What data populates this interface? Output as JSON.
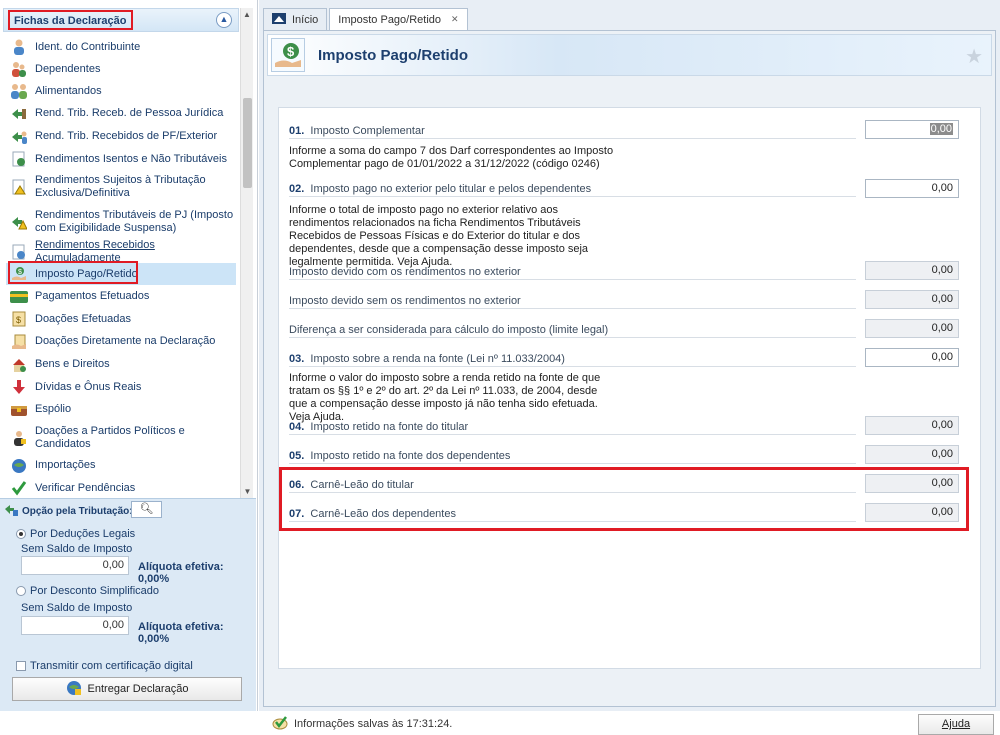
{
  "sidebar": {
    "title": "Fichas da Declaração",
    "items": [
      {
        "label": "Ident. do Contribuinte",
        "icon": "person-icon"
      },
      {
        "label": "Dependentes",
        "icon": "dependents-icon"
      },
      {
        "label": "Alimentandos",
        "icon": "alimentandos-icon"
      },
      {
        "label": "Rend. Trib. Receb. de Pessoa Jurídica",
        "icon": "income-pj-icon"
      },
      {
        "label": "Rend. Trib. Recebidos de PF/Exterior",
        "icon": "income-pf-icon"
      },
      {
        "label": "Rendimentos Isentos e Não Tributáveis",
        "icon": "exempt-income-icon"
      },
      {
        "label": "Rendimentos Sujeitos à Tributação Exclusiva/Definitiva",
        "icon": "exclusive-tax-icon"
      },
      {
        "label": "Rendimentos Tributáveis de PJ (Imposto com Exigibilidade Suspensa)",
        "icon": "suspended-tax-icon"
      },
      {
        "label": "Rendimentos Recebidos Acumuladamente",
        "icon": "accumulated-income-icon"
      },
      {
        "label": "Imposto Pago/Retido",
        "icon": "tax-paid-icon"
      },
      {
        "label": "Pagamentos Efetuados",
        "icon": "payments-icon"
      },
      {
        "label": "Doações Efetuadas",
        "icon": "donations-icon"
      },
      {
        "label": "Doações Diretamente na Declaração",
        "icon": "direct-donations-icon"
      },
      {
        "label": "Bens e Direitos",
        "icon": "assets-icon"
      },
      {
        "label": "Dívidas e Ônus Reais",
        "icon": "debts-icon"
      },
      {
        "label": "Espólio",
        "icon": "estate-icon"
      },
      {
        "label": "Doações a Partidos Políticos e Candidatos",
        "icon": "political-donations-icon"
      },
      {
        "label": "Importações",
        "icon": "imports-icon"
      },
      {
        "label": "Verificar Pendências",
        "icon": "checkmark-icon"
      }
    ]
  },
  "opcao": {
    "title": "Opção pela Tributação:",
    "deducoes_label": "Por Deduções Legais",
    "deducoes_sub": "Sem Saldo de Imposto",
    "deducoes_value": "0,00",
    "deducoes_aliquota": "Alíquota efetiva: 0,00%",
    "simplificado_label": "Por Desconto Simplificado",
    "simplificado_sub": "Sem Saldo de Imposto",
    "simplificado_value": "0,00",
    "simplificado_aliquota": "Alíquota efetiva: 0,00%",
    "cert_label": "Transmitir com certificação digital",
    "entregar_label": "Entregar Declaração"
  },
  "tabs": [
    {
      "label": "Início"
    },
    {
      "label": "Imposto Pago/Retido"
    }
  ],
  "page": {
    "title": "Imposto Pago/Retido"
  },
  "form": {
    "r01_num": "01.",
    "r01_label": "Imposto Complementar",
    "r01_value": "0,00",
    "r01_info": "Informe a soma do campo 7 dos Darf correspondentes ao Imposto Complementar pago de 01/01/2022 a 31/12/2022 (código 0246)",
    "r02_num": "02.",
    "r02_label": "Imposto pago no exterior pelo titular e pelos dependentes",
    "r02_value": "0,00",
    "r02_info": "Informe o total de imposto pago no exterior relativo aos rendimentos relacionados na ficha Rendimentos Tributáveis Recebidos de Pessoas Físicas e do Exterior do titular e dos dependentes, desde que a compensação desse imposto seja legalmente permitida. Veja Ajuda.",
    "devido_com_label": "Imposto devido com os rendimentos no exterior",
    "devido_com_value": "0,00",
    "devido_sem_label": "Imposto devido sem os rendimentos no exterior",
    "devido_sem_value": "0,00",
    "diferenca_label": "Diferença a ser considerada para cálculo do imposto (limite legal)",
    "diferenca_value": "0,00",
    "r03_num": "03.",
    "r03_label": "Imposto sobre a renda na fonte (Lei nº 11.033/2004)",
    "r03_value": "0,00",
    "r03_info": "Informe o valor do imposto sobre a renda retido na fonte de que tratam os §§ 1º e 2º do art. 2º da Lei nº 11.033, de 2004, desde que a compensação desse imposto já não tenha sido efetuada. Veja Ajuda.",
    "r04_num": "04.",
    "r04_label": "Imposto retido na fonte do titular",
    "r04_value": "0,00",
    "r05_num": "05.",
    "r05_label": "Imposto retido na fonte dos dependentes",
    "r05_value": "0,00",
    "r06_num": "06.",
    "r06_label": "Carnê-Leão do titular",
    "r06_value": "0,00",
    "r07_num": "07.",
    "r07_label": "Carnê-Leão dos dependentes",
    "r07_value": "0,00"
  },
  "status": {
    "saved_text": "Informações salvas às 17:31:24.",
    "help_label": "Ajuda"
  },
  "colors": {
    "highlight": "#e01b24",
    "header_blue": "#1d3f6e",
    "selected_bg": "#cce4f7"
  }
}
